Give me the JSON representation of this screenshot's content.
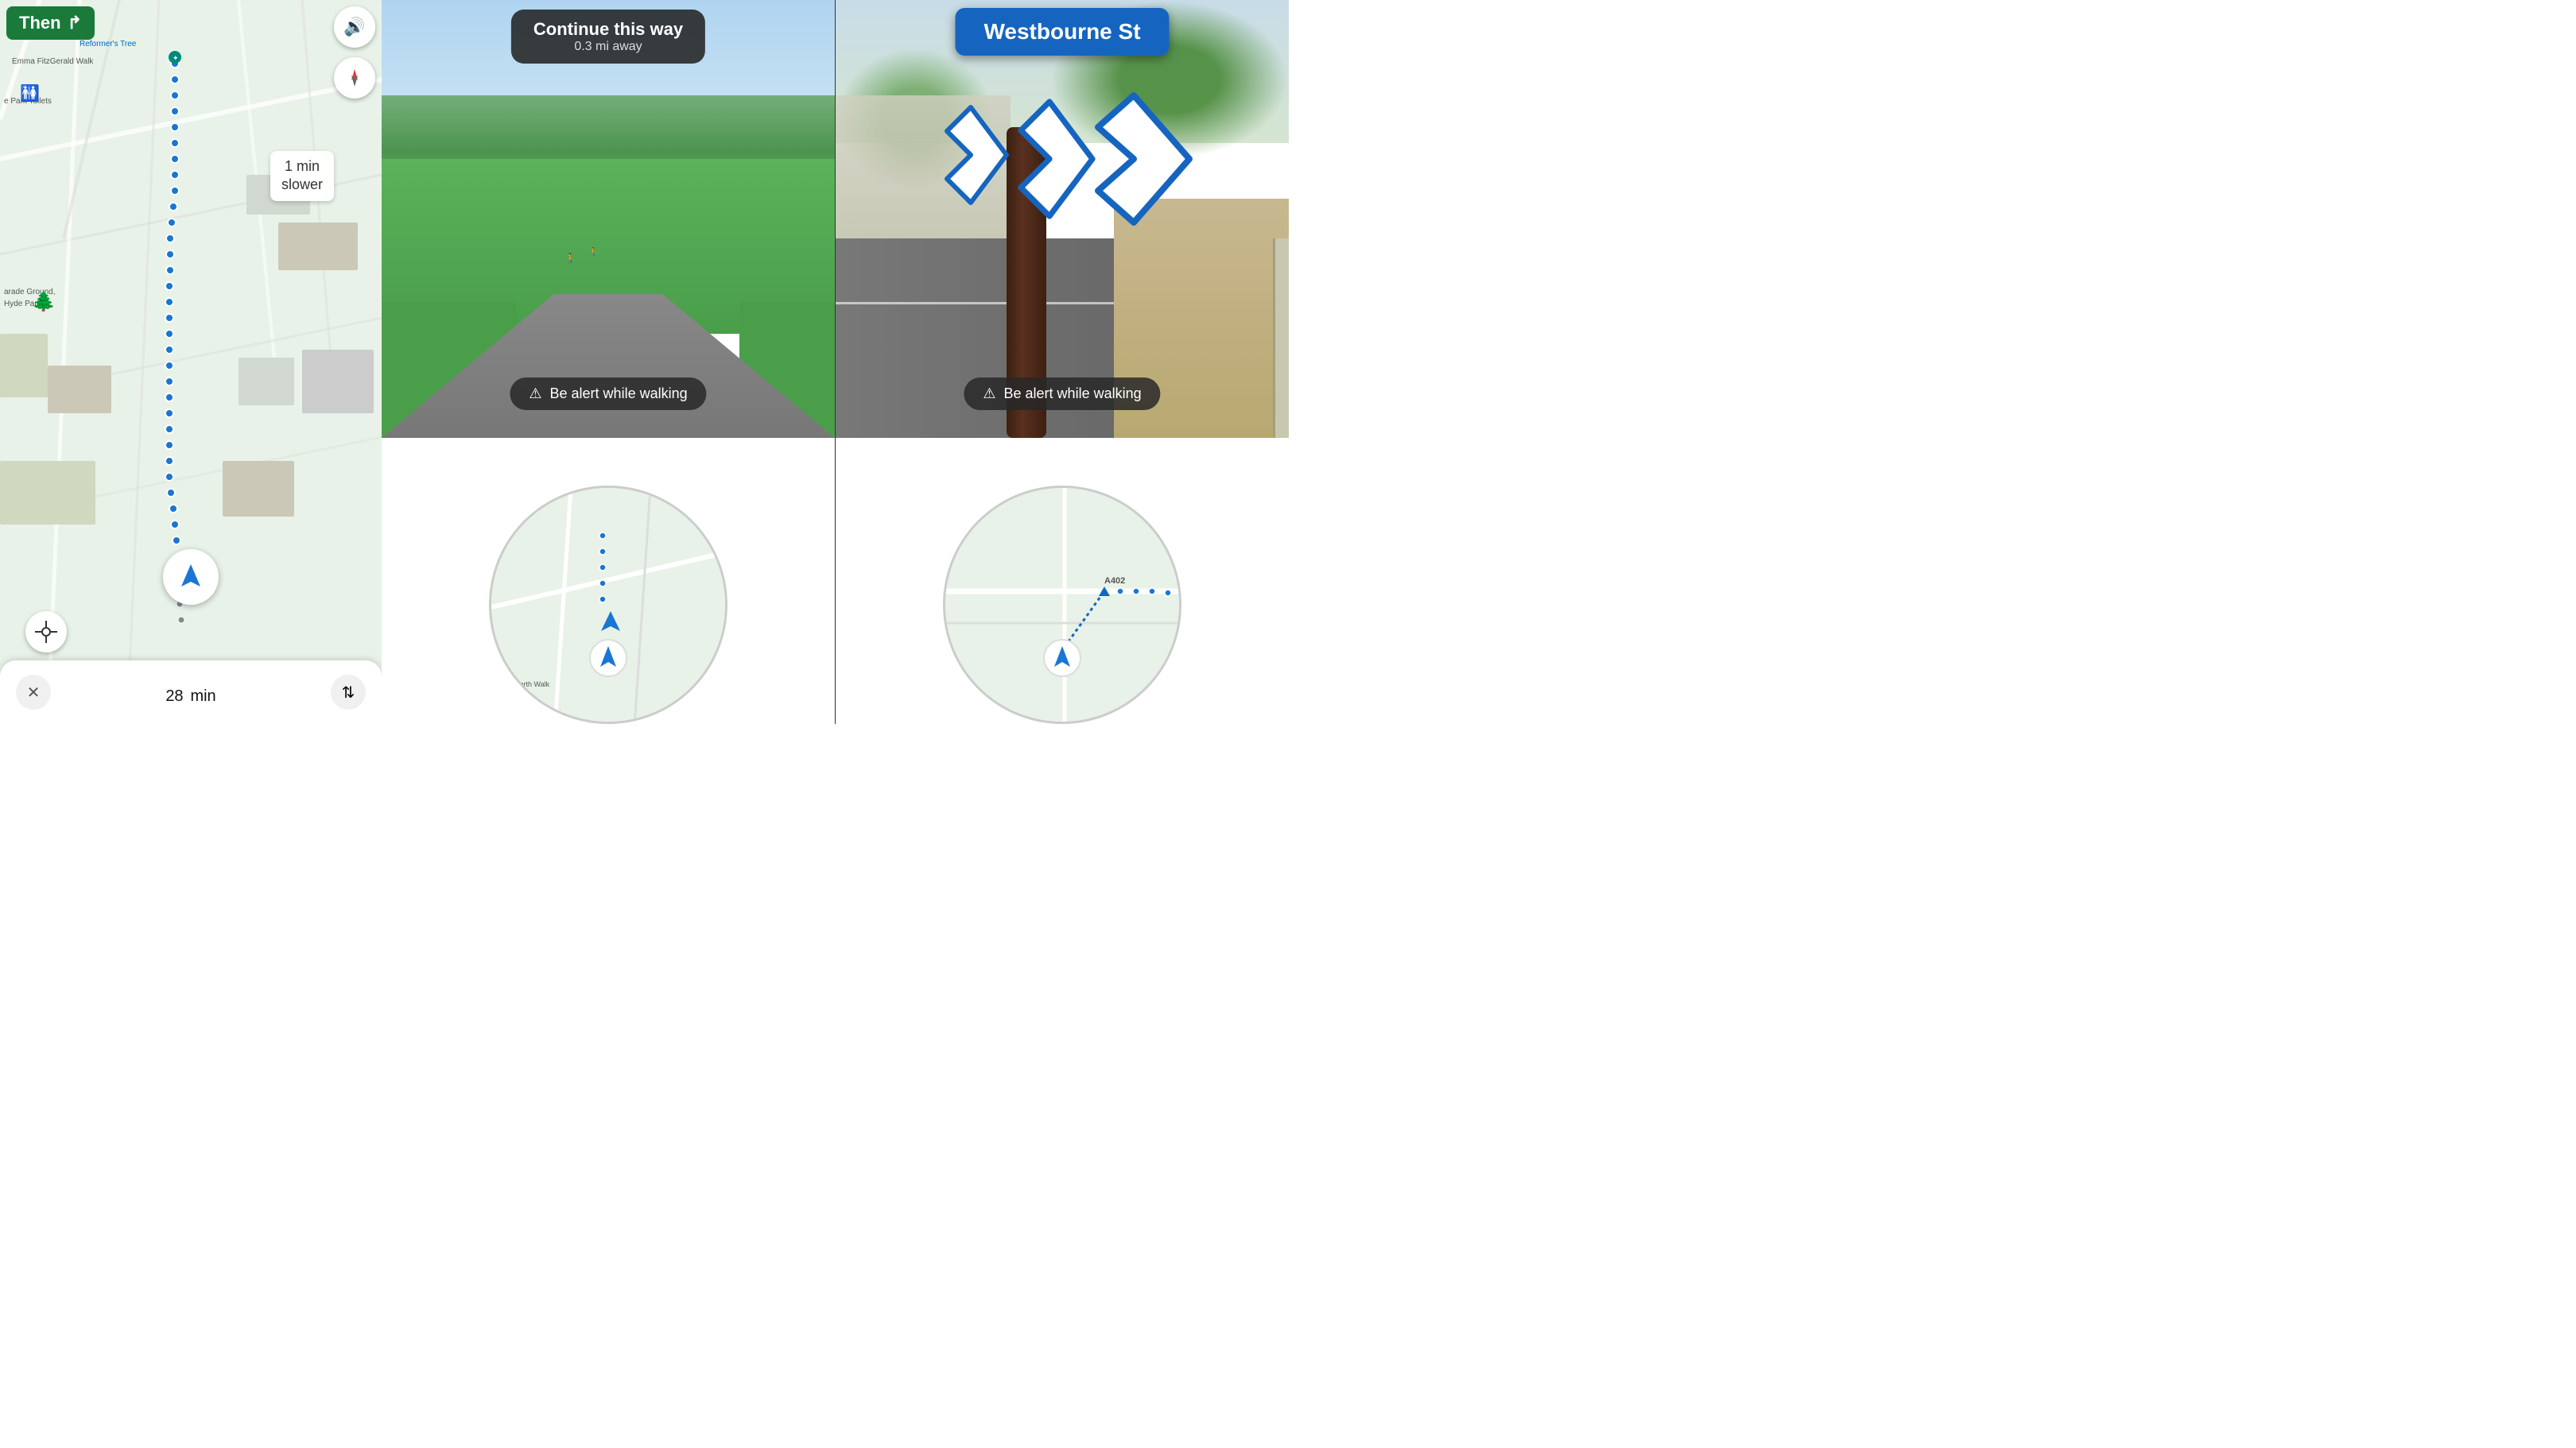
{
  "panels": {
    "map": {
      "then_label": "Then",
      "then_arrow": "↱",
      "slower_tooltip_line1": "1 min",
      "slower_tooltip_line2": "slower",
      "time_label": "28",
      "time_unit": "min",
      "reformers_tree": "Reformer's Tree",
      "hyde_park_label": "Parade Ground,\nHyde Park",
      "walk_label": "Emma FitzGerald Walk"
    },
    "ar_center": {
      "nav_title": "Continue this way",
      "nav_subtitle": "0.3 mi away",
      "alert_text": "Be alert while walking",
      "alert_icon": "⚠"
    },
    "ar_right": {
      "street_name": "Westbourne St",
      "alert_text": "Be alert while walking",
      "alert_icon": "⚠",
      "road_label": "A402"
    }
  },
  "colors": {
    "then_bg": "#1a7a3a",
    "street_banner_bg": "#1565C0",
    "blue_route": "#1976D2",
    "alert_bg": "rgba(40,40,40,0.85)",
    "map_bg": "#e8f2e8"
  }
}
